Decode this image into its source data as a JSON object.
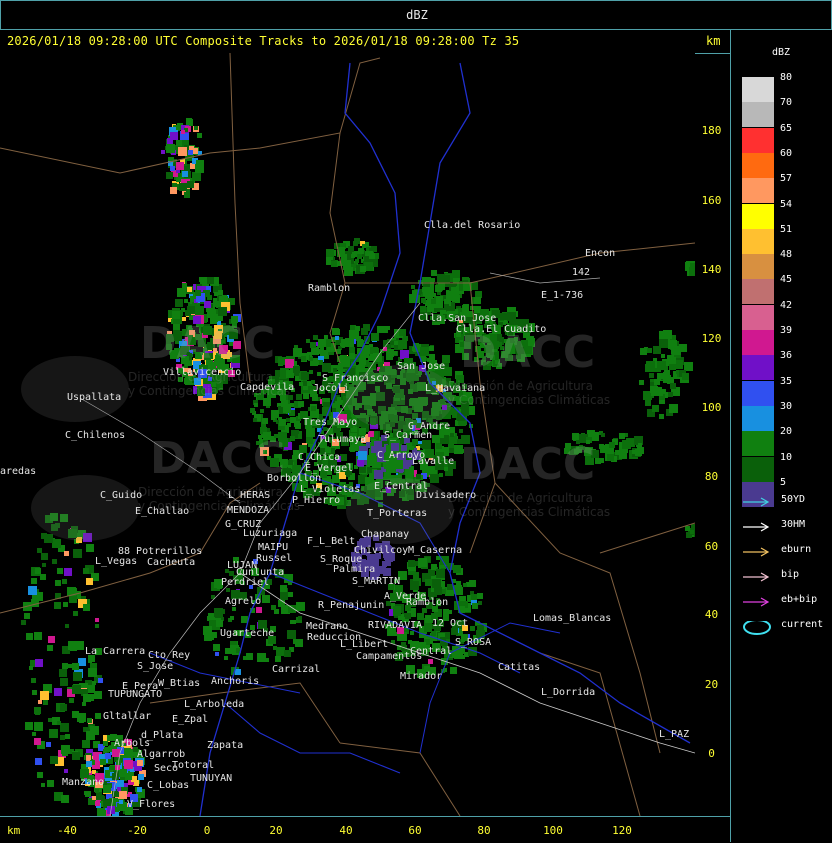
{
  "window": {
    "title": "dBZ"
  },
  "header": {
    "title": "2026/01/18 09:28:00 UTC Composite Tracks to 2026/01/18 09:28:00 Tz 35",
    "km_label": "km"
  },
  "x_axis": {
    "km_label": "km",
    "ticks": [
      "-40",
      "-20",
      "0",
      "20",
      "40",
      "60",
      "80",
      "100",
      "120"
    ]
  },
  "y_axis": {
    "ticks": [
      "180",
      "160",
      "140",
      "120",
      "100",
      "80",
      "60",
      "40",
      "20",
      "0"
    ]
  },
  "color_scale": {
    "title": "dBZ",
    "levels": [
      {
        "label": "80",
        "color": "#d8d8d8"
      },
      {
        "label": "70",
        "color": "#b8b8b8"
      },
      {
        "label": "65",
        "color": "#ff3030"
      },
      {
        "label": "60",
        "color": "#ff6a10"
      },
      {
        "label": "57",
        "color": "#ff9860"
      },
      {
        "label": "54",
        "color": "#ffff00"
      },
      {
        "label": "51",
        "color": "#ffc030"
      },
      {
        "label": "48",
        "color": "#d89040"
      },
      {
        "label": "45",
        "color": "#c07070"
      },
      {
        "label": "42",
        "color": "#d86090"
      },
      {
        "label": "39",
        "color": "#d01890"
      },
      {
        "label": "36",
        "color": "#7010c8"
      },
      {
        "label": "35",
        "color": "#3050f0"
      },
      {
        "label": "30",
        "color": "#1890e0"
      },
      {
        "label": "20",
        "color": "#108010"
      },
      {
        "label": "10",
        "color": "#0a600a"
      },
      {
        "label": "5",
        "color": "#4a3a90"
      }
    ]
  },
  "track_legend": [
    {
      "label": "50YD",
      "color": "#40d0e0",
      "shape": "arrow"
    },
    {
      "label": "30HM",
      "color": "#ffffff",
      "shape": "arrow"
    },
    {
      "label": "eburn",
      "color": "#f0c060",
      "shape": "arrow"
    },
    {
      "label": "bip",
      "color": "#f0c0d0",
      "shape": "arrow"
    },
    {
      "label": "eb+bip",
      "color": "#e040e0",
      "shape": "arrow"
    },
    {
      "label": "current",
      "color": "#40e0f0",
      "shape": "ellipse"
    }
  ],
  "places": [
    {
      "name": "Clla.del Rosario"
    },
    {
      "name": "Encon"
    },
    {
      "name": "142"
    },
    {
      "name": "E_1-736"
    },
    {
      "name": "Ramblon"
    },
    {
      "name": "Clla.San Jose"
    },
    {
      "name": "Clla.El Cuadito"
    },
    {
      "name": "Uspallata"
    },
    {
      "name": "Villavicencio"
    },
    {
      "name": "Capdevila"
    },
    {
      "name": "S_Francisco"
    },
    {
      "name": "Jocoli"
    },
    {
      "name": "San Jose"
    },
    {
      "name": "L_Havaiana"
    },
    {
      "name": "C_Chilenos"
    },
    {
      "name": "Tres Mayo"
    },
    {
      "name": "Tulumaya"
    },
    {
      "name": "S_Carmen"
    },
    {
      "name": "G_Andre"
    },
    {
      "name": "aredas"
    },
    {
      "name": "C_Chica"
    },
    {
      "name": "E_Vergel"
    },
    {
      "name": "C_Arroyo"
    },
    {
      "name": "Lavalle"
    },
    {
      "name": "Borbollon"
    },
    {
      "name": "L_Violetas"
    },
    {
      "name": "E_Central"
    },
    {
      "name": "Divisadero"
    },
    {
      "name": "C_Guido"
    },
    {
      "name": "L_HERAS"
    },
    {
      "name": "P_Hierro"
    },
    {
      "name": "E_Challao"
    },
    {
      "name": "MENDOZA"
    },
    {
      "name": "T_Porteras"
    },
    {
      "name": "G_CRUZ"
    },
    {
      "name": "Luzuriaga"
    },
    {
      "name": "Chapanay"
    },
    {
      "name": "F_L_Belt"
    },
    {
      "name": "MAIPU"
    },
    {
      "name": "Chivilcoy"
    },
    {
      "name": "M_Caserna"
    },
    {
      "name": "88 Potrerillos"
    },
    {
      "name": "L_Vegas"
    },
    {
      "name": "Cacheuta"
    },
    {
      "name": "Russel"
    },
    {
      "name": "S_Roque"
    },
    {
      "name": "LUJAN"
    },
    {
      "name": "Palmira"
    },
    {
      "name": "Cunlunta"
    },
    {
      "name": "Perdriel"
    },
    {
      "name": "S_MARTIN"
    },
    {
      "name": "A_Verde"
    },
    {
      "name": "Agrelo"
    },
    {
      "name": "R_Penajunin"
    },
    {
      "name": "Ramblon"
    },
    {
      "name": "12 Oct"
    },
    {
      "name": "Lomas_Blancas"
    },
    {
      "name": "Ugarteche"
    },
    {
      "name": "Medrano"
    },
    {
      "name": "RIVADAVIA"
    },
    {
      "name": "Reduccion"
    },
    {
      "name": "L_Libert"
    },
    {
      "name": "S_ROSA"
    },
    {
      "name": "La Carrera"
    },
    {
      "name": "Cto_Rey"
    },
    {
      "name": "Campamentos"
    },
    {
      "name": "Central"
    },
    {
      "name": "S_Jose"
    },
    {
      "name": "Catitas"
    },
    {
      "name": "W_Btias"
    },
    {
      "name": "Anchoris"
    },
    {
      "name": "Carrizal"
    },
    {
      "name": "Mirador"
    },
    {
      "name": "E_Pera"
    },
    {
      "name": "TUPUNGATO"
    },
    {
      "name": "L_Dorrida"
    },
    {
      "name": "L_Arboleda"
    },
    {
      "name": "Gltallar"
    },
    {
      "name": "E_Zpal"
    },
    {
      "name": "d_Plata"
    },
    {
      "name": "L_PAZ"
    },
    {
      "name": "Arbols"
    },
    {
      "name": "Zapata"
    },
    {
      "name": "Algarrob"
    },
    {
      "name": "Totoral"
    },
    {
      "name": "Manzano"
    },
    {
      "name": "Seco"
    },
    {
      "name": "TUNUYAN"
    },
    {
      "name": "C_Lobas"
    },
    {
      "name": "V_Flores"
    }
  ],
  "watermarks": [
    {
      "logo": "DACC",
      "line1": "Dirección de Agricultura",
      "line2": "y Contingencias Climáticas"
    }
  ]
}
